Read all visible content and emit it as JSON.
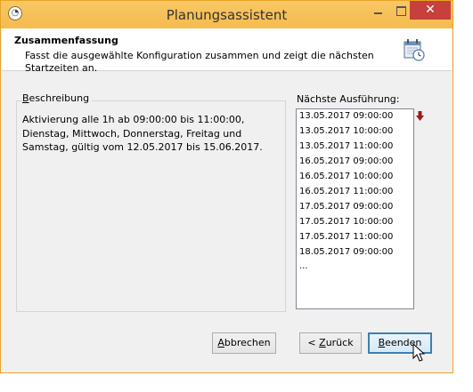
{
  "window": {
    "title": "Planungsassistent",
    "close_glyph": "✕"
  },
  "header": {
    "title": "Zusammenfassung",
    "description": "Fasst die ausgewählte Konfiguration zusammen und zeigt die nächsten Startzeiten an.",
    "icon": "calendar-clock-icon"
  },
  "description_group": {
    "label": "Beschreibung",
    "label_accel": "B",
    "label_rest": "eschreibung",
    "text": "Aktivierung alle 1h ab 09:00:00 bis 11:00:00, Dienstag, Mittwoch, Donnerstag, Freitag und Samstag, gültig vom 12.05.2017 bis 15.06.2017."
  },
  "next_runs": {
    "label": "Nächste Ausführung:",
    "items": [
      "13.05.2017 09:00:00",
      "13.05.2017 10:00:00",
      "13.05.2017 11:00:00",
      "16.05.2017 09:00:00",
      "16.05.2017 10:00:00",
      "16.05.2017 11:00:00",
      "17.05.2017 09:00:00",
      "17.05.2017 10:00:00",
      "17.05.2017 11:00:00",
      "18.05.2017 09:00:00",
      "..."
    ],
    "more_icon": "red-down-arrow-icon"
  },
  "buttons": {
    "cancel": {
      "accel": "A",
      "rest": "bbrechen"
    },
    "back": {
      "prefix": "< ",
      "accel": "Z",
      "rest": "urück"
    },
    "finish": {
      "accel": "B",
      "rest": "eenden"
    }
  },
  "colors": {
    "titlebar": "#f7c05a",
    "close": "#c7413c",
    "arrow": "#9b1c1c"
  }
}
